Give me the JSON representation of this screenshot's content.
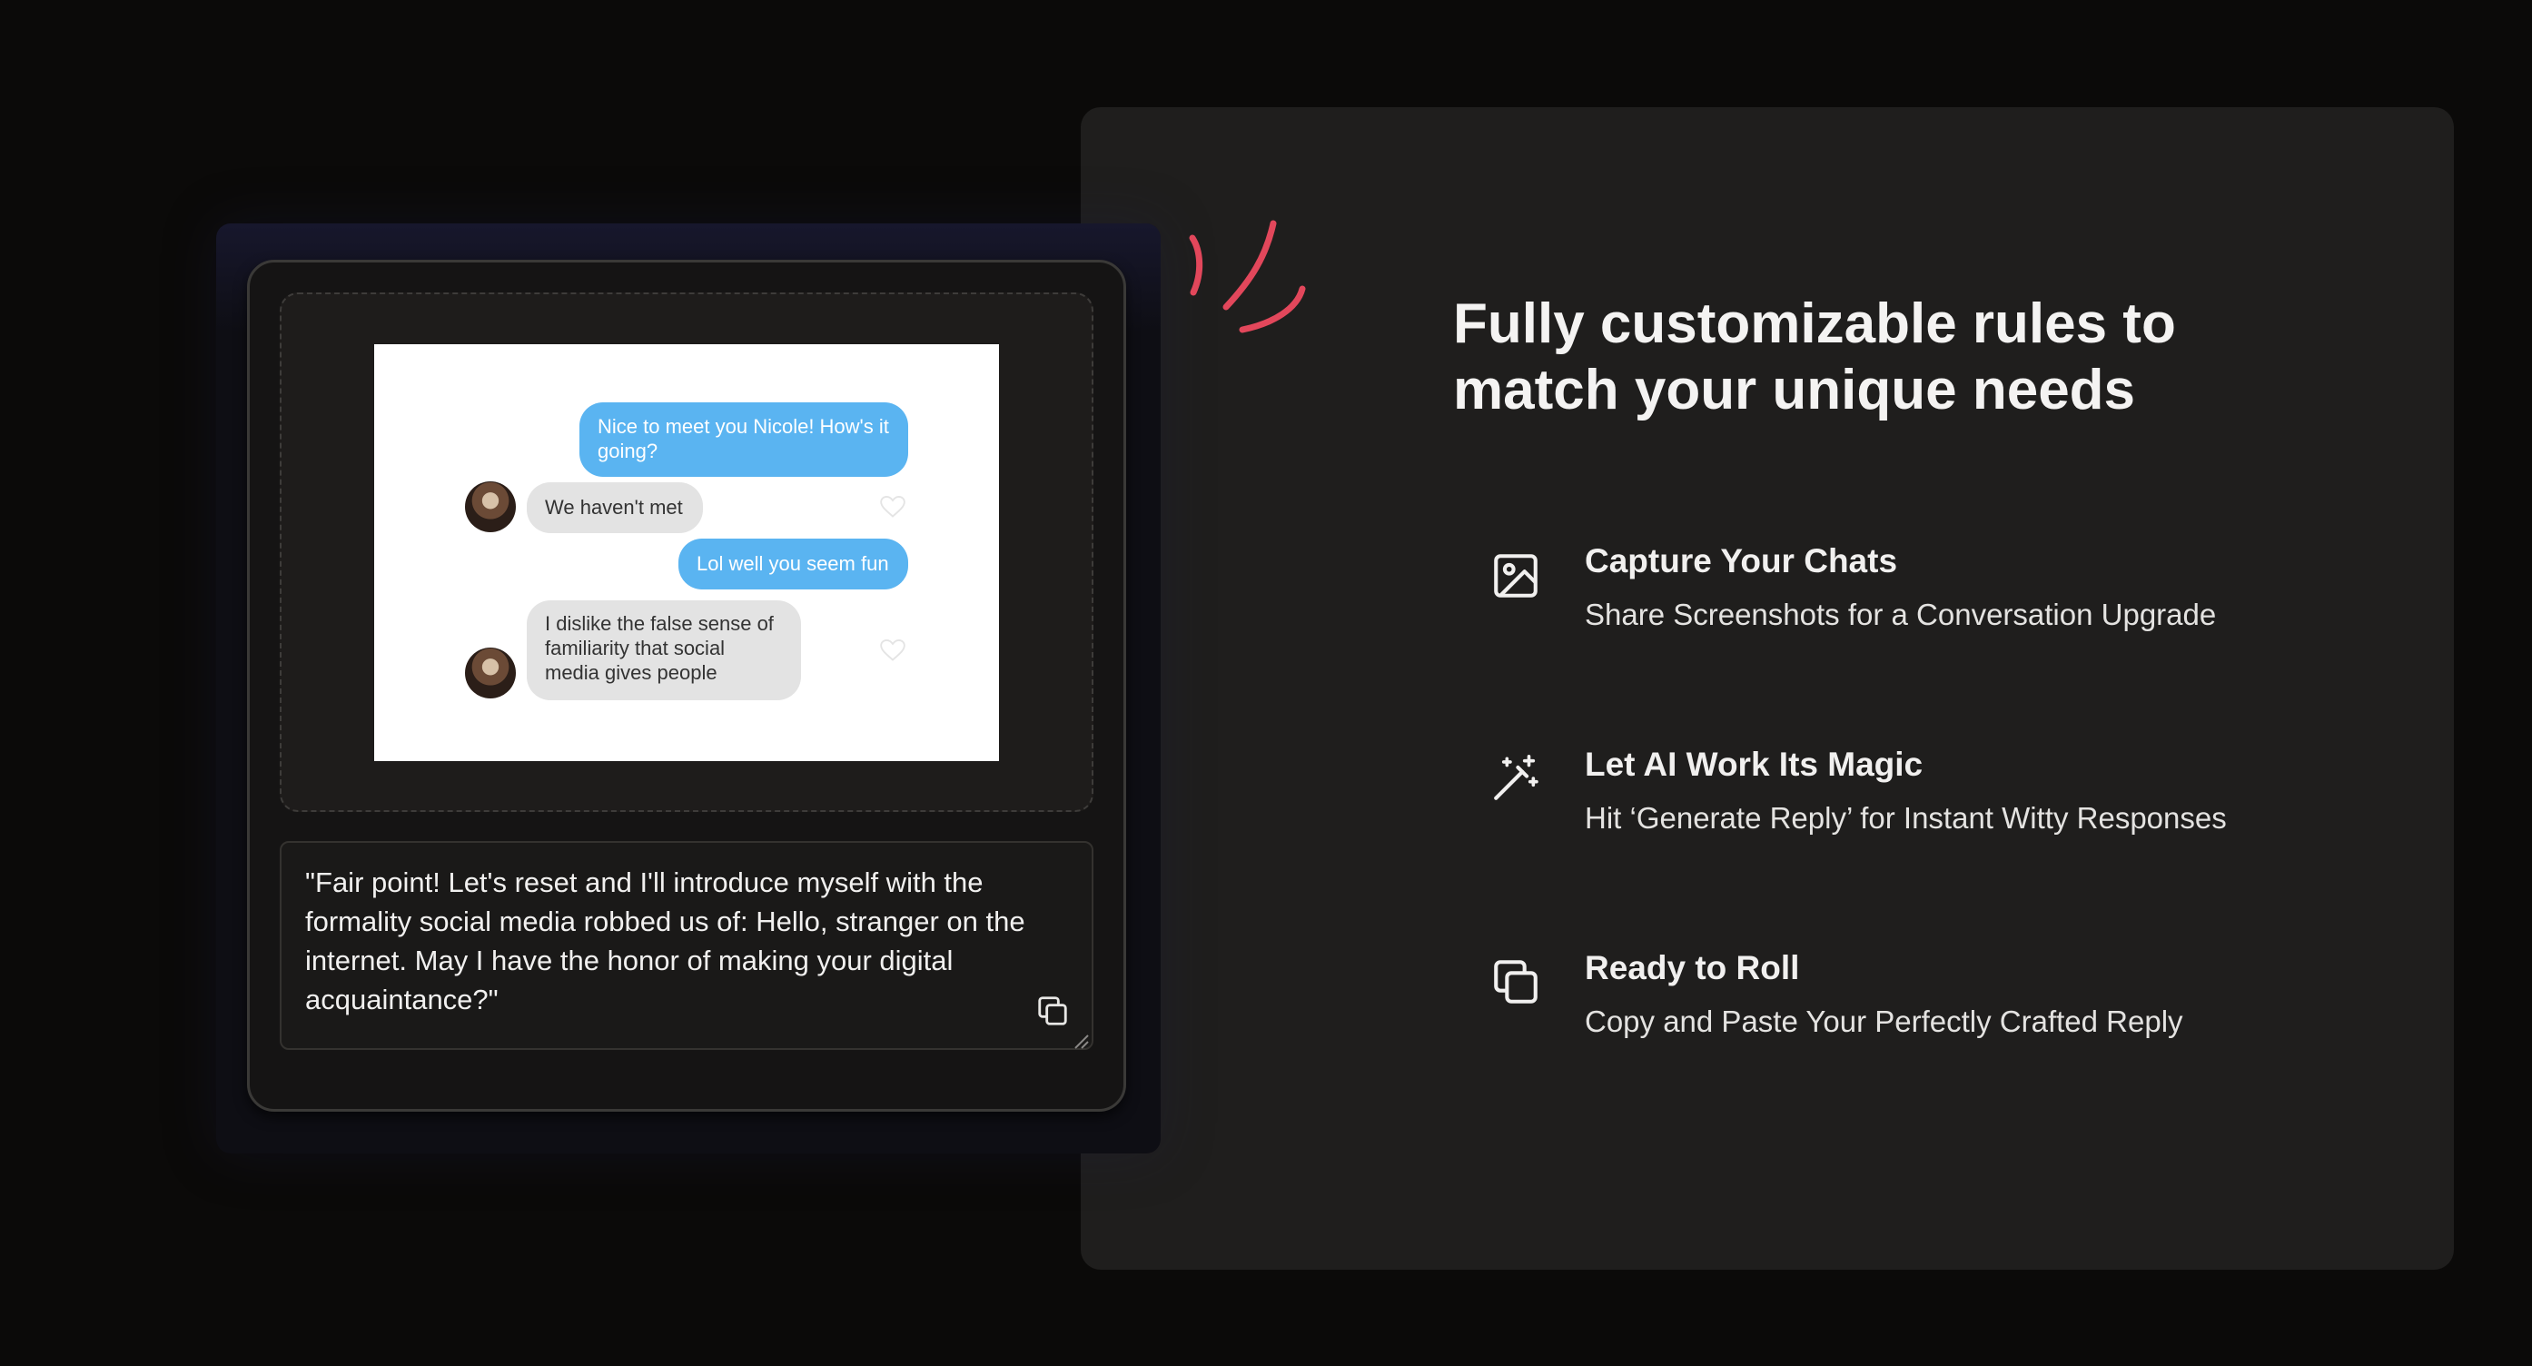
{
  "chat_preview": {
    "messages": [
      {
        "sender": "me",
        "text": "Nice to meet you Nicole! How's it going?"
      },
      {
        "sender": "them",
        "text": "We haven't met"
      },
      {
        "sender": "me",
        "text": "Lol well you seem fun"
      },
      {
        "sender": "them",
        "text": "I dislike the false sense of familiarity that social media gives people"
      }
    ]
  },
  "reply": {
    "text": "\"Fair point! Let's reset and I'll introduce myself with the formality social media robbed us of: Hello, stranger on the internet. May I have the honor of making your digital acquaintance?\""
  },
  "heading": "Fully customizable rules to match your unique needs",
  "features": [
    {
      "icon": "image-icon",
      "title": "Capture Your Chats",
      "description": "Share Screenshots for a Conversation Upgrade"
    },
    {
      "icon": "magic-wand-icon",
      "title": "Let AI Work Its Magic",
      "description": "Hit ‘Generate Reply’ for Instant Witty Responses"
    },
    {
      "icon": "copy-icon",
      "title": "Ready to Roll",
      "description": "Copy and Paste Your Perfectly Crafted Reply"
    }
  ],
  "colors": {
    "page_background": "#0b0a09",
    "panel_background": "#1f1e1d",
    "outgoing_bubble": "#5ab4f1",
    "incoming_bubble": "#e3e3e3",
    "accent_doodle": "#e2475b"
  }
}
